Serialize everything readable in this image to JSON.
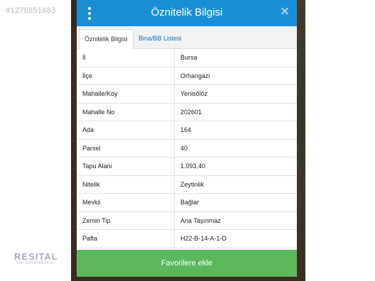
{
  "listing_id": "#1278851683",
  "watermark": {
    "brand": "RESITAL",
    "sub": "TEK GAYRİMENKUL"
  },
  "modal": {
    "title": "Öznitelik Bilgisi",
    "close_icon": "close-icon",
    "menu_icon": "vertical-dots-icon",
    "tabs": [
      {
        "label": "Öznitelik Bilgisi",
        "active": true
      },
      {
        "label": "Bina/BB Listesi",
        "active": false
      }
    ],
    "rows": [
      {
        "key": "İl",
        "value": "Bursa"
      },
      {
        "key": "İlçe",
        "value": "Orhangazi"
      },
      {
        "key": "Mahalle/Köy",
        "value": "Yenisölöz"
      },
      {
        "key": "Mahalle No",
        "value": "202601"
      },
      {
        "key": "Ada",
        "value": "164"
      },
      {
        "key": "Parsel",
        "value": "40"
      },
      {
        "key": "Tapu Alanı",
        "value": "1.093,40"
      },
      {
        "key": "Nitelik",
        "value": "Zeytinlik"
      },
      {
        "key": "Mevkii",
        "value": "Bağlar"
      },
      {
        "key": "Zemin Tip",
        "value": "Ana Taşınmaz"
      },
      {
        "key": "Pafta",
        "value": "H22-B-14-A-1-D"
      }
    ],
    "favorite_button": "Favorilere ekle"
  },
  "colors": {
    "header": "#1b8fd6",
    "button": "#5cb85c",
    "tab_link": "#1b6fb3"
  }
}
